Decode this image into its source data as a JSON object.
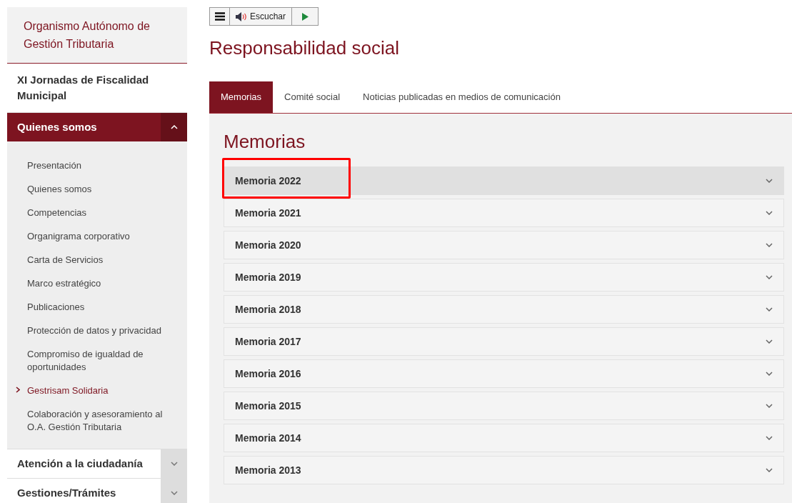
{
  "sidebar": {
    "title": "Organismo Autónomo de Gestión Tributaria",
    "items": [
      {
        "kind": "link",
        "label": "XI Jornadas de Fiscalidad Municipal"
      },
      {
        "kind": "section",
        "label": "Quienes somos",
        "expanded": true,
        "children": [
          {
            "label": "Presentación",
            "selected": false
          },
          {
            "label": "Quienes somos",
            "selected": false
          },
          {
            "label": "Competencias",
            "selected": false
          },
          {
            "label": "Organigrama corporativo",
            "selected": false
          },
          {
            "label": "Carta de Servicios",
            "selected": false
          },
          {
            "label": "Marco estratégico",
            "selected": false
          },
          {
            "label": "Publicaciones",
            "selected": false
          },
          {
            "label": "Protección de datos y privacidad",
            "selected": false
          },
          {
            "label": "Compromiso de igualdad de oportunidades",
            "selected": false
          },
          {
            "label": "Gestrisam Solidaria",
            "selected": true
          },
          {
            "label": "Colaboración y asesoramiento al O.A. Gestión Tributaria",
            "selected": false
          }
        ]
      },
      {
        "kind": "section",
        "label": "Atención a la ciudadanía",
        "expanded": false
      },
      {
        "kind": "section",
        "label": "Gestiones/Trámites",
        "expanded": false
      }
    ]
  },
  "toolbar": {
    "listen_label": "Escuchar"
  },
  "page_title": "Responsabilidad social",
  "tabs": [
    {
      "label": "Memorias",
      "selected": true
    },
    {
      "label": "Comité social",
      "selected": false
    },
    {
      "label": "Noticias publicadas en medios de comunicación",
      "selected": false
    }
  ],
  "section_title": "Memorias",
  "accordion": [
    {
      "label": "Memoria 2022",
      "highlighted": true
    },
    {
      "label": "Memoria 2021",
      "highlighted": false
    },
    {
      "label": "Memoria 2020",
      "highlighted": false
    },
    {
      "label": "Memoria 2019",
      "highlighted": false
    },
    {
      "label": "Memoria 2018",
      "highlighted": false
    },
    {
      "label": "Memoria 2017",
      "highlighted": false
    },
    {
      "label": "Memoria 2016",
      "highlighted": false
    },
    {
      "label": "Memoria 2015",
      "highlighted": false
    },
    {
      "label": "Memoria 2014",
      "highlighted": false
    },
    {
      "label": "Memoria 2013",
      "highlighted": false
    }
  ]
}
